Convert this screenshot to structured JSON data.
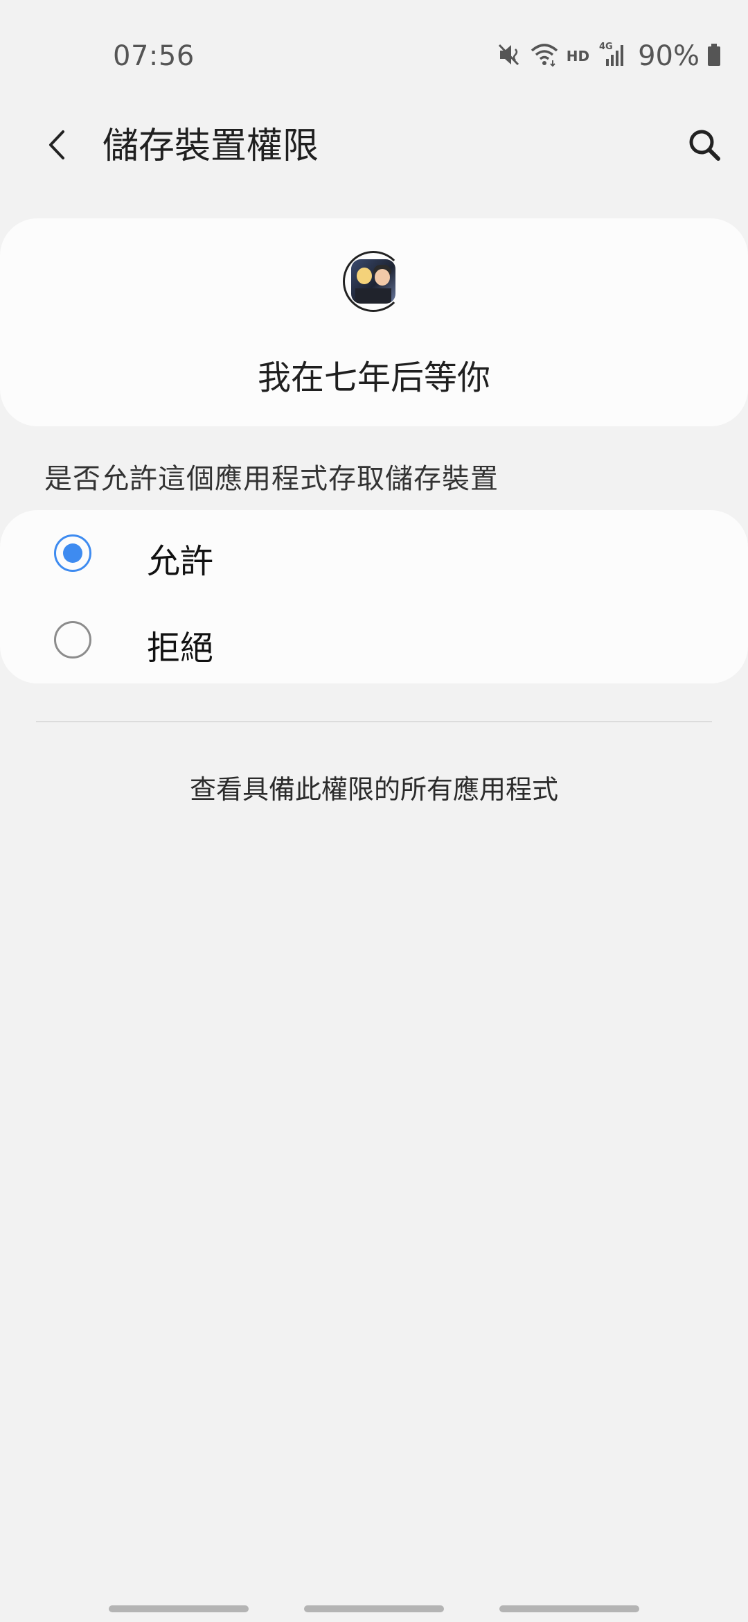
{
  "status_bar": {
    "time": "07:56",
    "hd_label": "HD",
    "network_label": "4G",
    "battery_percent": "90%",
    "icons": [
      "mute-icon",
      "wifi-icon",
      "signal-icon",
      "battery-icon"
    ]
  },
  "app_bar": {
    "title": "儲存裝置權限",
    "back_icon": "chevron-left-icon",
    "search_icon": "search-icon"
  },
  "app_card": {
    "app_name": "我在七年后等你"
  },
  "permission": {
    "question": "是否允許這個應用程式存取儲存裝置",
    "options": [
      {
        "label": "允許",
        "selected": true
      },
      {
        "label": "拒絕",
        "selected": false
      }
    ],
    "accent_color": "#3e8bf0"
  },
  "see_all_link": "查看具備此權限的所有應用程式"
}
